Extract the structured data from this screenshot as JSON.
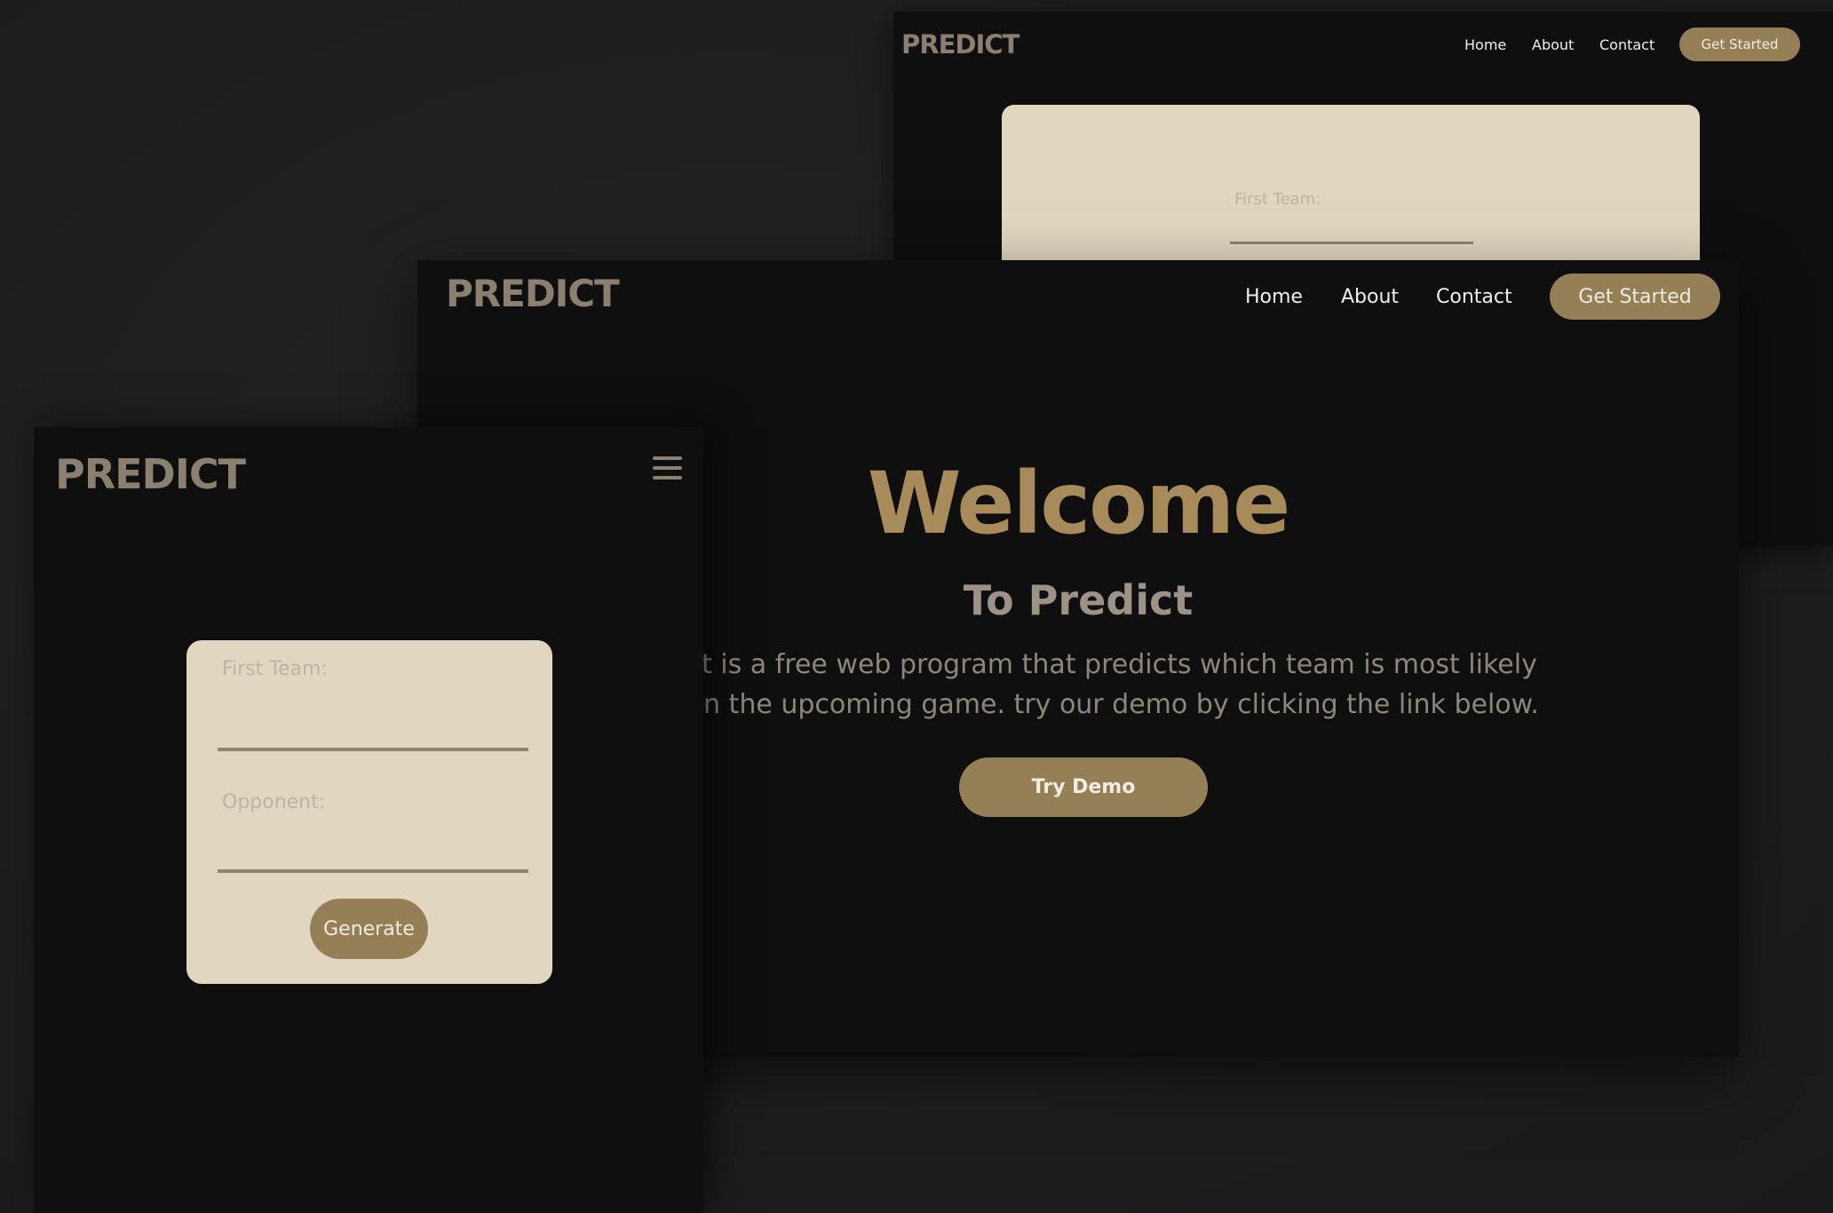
{
  "brand": {
    "logo": "PREDICT"
  },
  "nav": {
    "home": "Home",
    "about": "About",
    "contact": "Contact",
    "cta": "Get Started"
  },
  "hero": {
    "title": "Welcome",
    "subtitle": "To Predict",
    "description_line1": "t is a free web program that predicts which team is most likely",
    "description_line2": "n the upcoming game. try our demo by clicking the link below.",
    "demo_button": "Try Demo"
  },
  "form": {
    "first_team_label": "First Team:",
    "opponent_label": "Opponent:",
    "generate_button": "Generate"
  },
  "colors": {
    "background": "#1e1e1f",
    "window": "#0f0f10",
    "accent": "#957f57",
    "title": "#a88b5a",
    "card": "#e1d6bf",
    "logo": "#8a8070"
  },
  "icons": {
    "menu": "hamburger-menu-icon"
  }
}
